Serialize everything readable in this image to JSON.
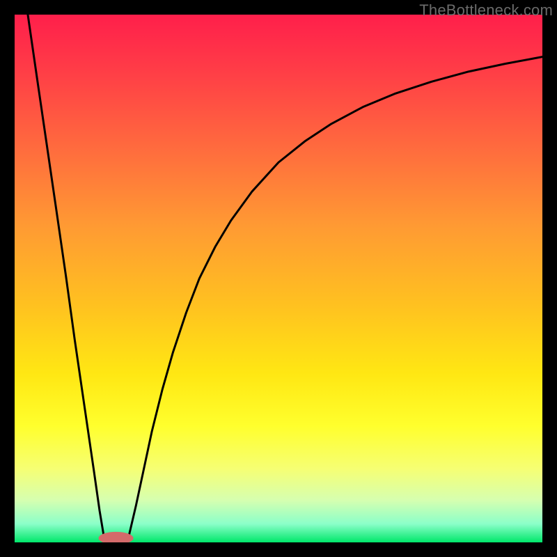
{
  "watermark": "TheBottleneck.com",
  "chart_data": {
    "type": "line",
    "title": "",
    "xlabel": "",
    "ylabel": "",
    "xlim": [
      0,
      100
    ],
    "ylim": [
      0,
      100
    ],
    "grid": false,
    "background_gradient_stops": [
      {
        "offset": 0.0,
        "color": "#ff1f4b"
      },
      {
        "offset": 0.1,
        "color": "#ff3b47"
      },
      {
        "offset": 0.25,
        "color": "#ff6a3e"
      },
      {
        "offset": 0.4,
        "color": "#ff9a33"
      },
      {
        "offset": 0.55,
        "color": "#ffc120"
      },
      {
        "offset": 0.68,
        "color": "#ffe713"
      },
      {
        "offset": 0.78,
        "color": "#ffff2d"
      },
      {
        "offset": 0.86,
        "color": "#f6ff73"
      },
      {
        "offset": 0.92,
        "color": "#d6ffb0"
      },
      {
        "offset": 0.965,
        "color": "#8bffc9"
      },
      {
        "offset": 1.0,
        "color": "#00e76a"
      }
    ],
    "series": [
      {
        "name": "left-curve",
        "x": [
          2.5,
          4.3,
          6.1,
          7.9,
          9.7,
          11.4,
          13.2,
          15.0,
          16.1,
          17.0
        ],
        "y": [
          100.0,
          87.6,
          75.3,
          63.0,
          50.6,
          38.3,
          26.0,
          13.7,
          6.0,
          0.6
        ]
      },
      {
        "name": "right-curve",
        "x": [
          21.5,
          23.0,
          24.5,
          26.0,
          28.0,
          30.0,
          32.5,
          35.0,
          38.0,
          41.0,
          45.0,
          50.0,
          55.0,
          60.0,
          66.0,
          72.0,
          79.0,
          86.0,
          93.0,
          100.0
        ],
        "y": [
          0.6,
          7.0,
          14.0,
          21.0,
          29.0,
          36.0,
          43.5,
          50.0,
          56.0,
          61.0,
          66.5,
          72.0,
          76.0,
          79.3,
          82.5,
          85.0,
          87.3,
          89.2,
          90.7,
          92.0
        ]
      }
    ],
    "marker": {
      "name": "min-marker",
      "cx": 19.2,
      "cy": 0.8,
      "rx": 3.3,
      "ry": 1.2,
      "color": "#d46a6a"
    }
  }
}
